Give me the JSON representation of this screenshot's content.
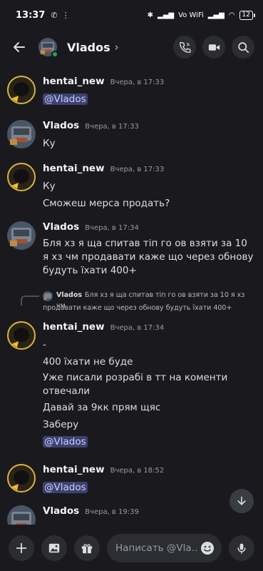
{
  "status_bar": {
    "time": "13:37",
    "network_label": "Vo WiFi",
    "battery": "12"
  },
  "header": {
    "title": "Vlados",
    "chevron": "›",
    "icons": [
      "back-arrow-icon",
      "phone-icon",
      "video-icon",
      "search-icon"
    ]
  },
  "messages": [
    {
      "author": "hentai_new",
      "timestamp": "Вчера, в 17:33",
      "lines": [
        {
          "text": "@Vlados",
          "mention": true
        }
      ]
    },
    {
      "author": "Vlados",
      "timestamp": "Вчера, в 17:33",
      "lines": [
        {
          "text": "Ку"
        }
      ]
    },
    {
      "author": "hentai_new",
      "timestamp": "Вчера, в 17:33",
      "lines": [
        {
          "text": "Ку"
        },
        {
          "text": "Сможеш мерса продать?"
        }
      ]
    },
    {
      "author": "Vlados",
      "timestamp": "Вчера, в 17:34",
      "lines": [
        {
          "text": "Бля хз я ща спитав тіп го ов взяти за 10 я хз чм продавати каже що через обнову будуть їхати 400+"
        }
      ]
    },
    {
      "author": "hentai_new",
      "timestamp": "Вчера, в 17:34",
      "reply": {
        "author": "Vlados",
        "text": "Бля хз я ща спитав тіп го ов взяти за 10 я хз чм",
        "text_cont": "продавати каже що через обнову будуть їхати 400+"
      },
      "lines": [
        {
          "text": "-"
        },
        {
          "text": "400 їхати не буде"
        },
        {
          "text": "Уже писали розрабі в тт на коменти отвечали"
        },
        {
          "text": "Давай за 9кк прям щяс"
        },
        {
          "text": "Заберу"
        },
        {
          "text": "@Vlados",
          "mention": true
        }
      ]
    },
    {
      "author": "hentai_new",
      "timestamp": "Вчера, в 18:52",
      "lines": [
        {
          "text": "@Vlados",
          "mention": true
        }
      ]
    },
    {
      "author": "Vlados",
      "timestamp": "Вчера, в 19:39",
      "lines": []
    }
  ],
  "composer": {
    "placeholder": "Написать @Vla…",
    "icons": [
      "plus-icon",
      "image-icon",
      "gift-icon",
      "emoji-icon",
      "microphone-icon"
    ]
  },
  "colors": {
    "background": "#1a1a1e",
    "surface": "#2b2d31",
    "mention_bg": "#3c4270",
    "mention_text": "#c9cdfb",
    "online": "#23a55a"
  }
}
